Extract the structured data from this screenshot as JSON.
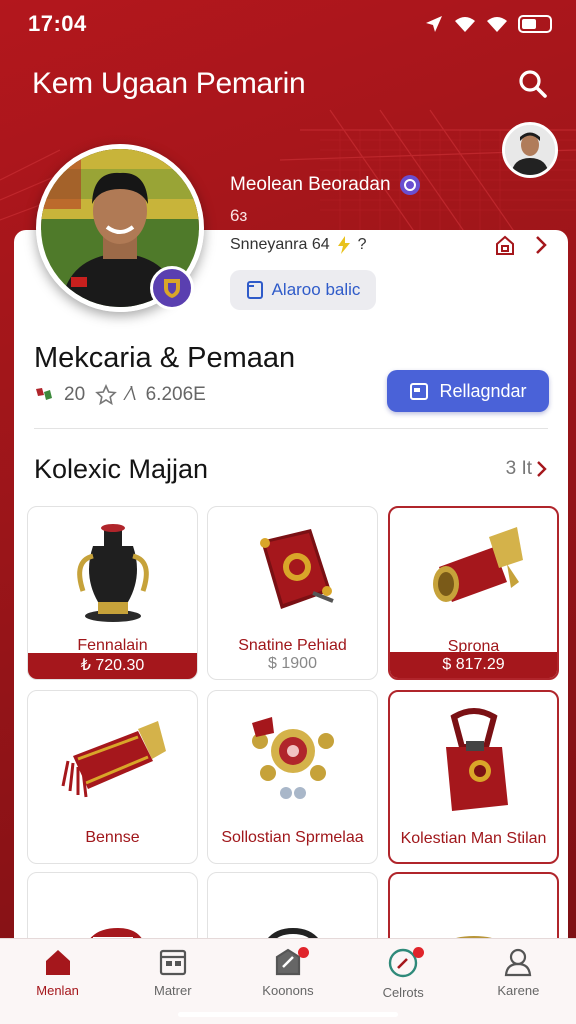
{
  "status_bar": {
    "time": "17:04"
  },
  "header": {
    "title": "Kem  Ugaan Pemarin"
  },
  "profile": {
    "name": "Meolean Beoradan",
    "meta_line": "6ɜ",
    "stats_text": "Snneyanra  64",
    "stats_suffix": "?",
    "chip_label": "Alaroo balic"
  },
  "section": {
    "title": "Mekcaria & Pemaan",
    "rating_value": "20",
    "separator": "⁄\\",
    "count": "6.206E",
    "action_label": "Rellagndar"
  },
  "collection": {
    "title": "Kolexic Majjan",
    "more_label": "3 It"
  },
  "items": [
    {
      "name": "Fennalain",
      "price": "₺ 720.30",
      "price_style": "bar"
    },
    {
      "name": "Snatine Pehiad",
      "price": "$ 1900",
      "price_style": "plain"
    },
    {
      "name": "Sprona",
      "price": "$ 817.29",
      "price_style": "bar"
    },
    {
      "name": "Bennse",
      "price": "",
      "price_style": "none"
    },
    {
      "name": "Sollostian Sprmelaa",
      "price": "",
      "price_style": "none"
    },
    {
      "name": "Kolestian Man Stilan",
      "price": "",
      "price_style": "none"
    },
    {
      "name": "",
      "price": "",
      "price_style": "none"
    },
    {
      "name": "",
      "price": "",
      "price_style": "none"
    },
    {
      "name": "",
      "price": "",
      "price_style": "none"
    }
  ],
  "nav": [
    {
      "label": "Menlan",
      "icon": "home-icon",
      "active": true
    },
    {
      "label": "Matrer",
      "icon": "calendar-icon",
      "active": false
    },
    {
      "label": "Koonons",
      "icon": "edit-icon",
      "active": false
    },
    {
      "label": "Celrots",
      "icon": "compass-icon",
      "active": false
    },
    {
      "label": "Karene",
      "icon": "user-icon",
      "active": false
    }
  ],
  "colors": {
    "brand_red": "#a5171c",
    "accent_blue": "#4a62d8",
    "badge_purple": "#5a3fb0"
  }
}
